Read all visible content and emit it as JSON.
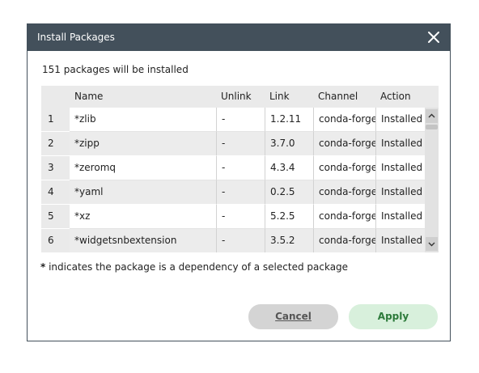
{
  "dialog": {
    "title": "Install Packages",
    "summary": "151 packages will be installed",
    "note_star": "*",
    "note_text": " indicates the package is a dependency of a selected package"
  },
  "table": {
    "columns": [
      "",
      "Name",
      "Unlink",
      "Link",
      "Channel",
      "Action"
    ],
    "rows": [
      {
        "num": "1",
        "name": "*zlib",
        "unlink": "-",
        "link": "1.2.11",
        "channel": "conda-forge",
        "action": "Installed"
      },
      {
        "num": "2",
        "name": "*zipp",
        "unlink": "-",
        "link": "3.7.0",
        "channel": "conda-forge",
        "action": "Installed"
      },
      {
        "num": "3",
        "name": "*zeromq",
        "unlink": "-",
        "link": "4.3.4",
        "channel": "conda-forge",
        "action": "Installed"
      },
      {
        "num": "4",
        "name": "*yaml",
        "unlink": "-",
        "link": "0.2.5",
        "channel": "conda-forge",
        "action": "Installed"
      },
      {
        "num": "5",
        "name": "*xz",
        "unlink": "-",
        "link": "5.2.5",
        "channel": "conda-forge",
        "action": "Installed"
      },
      {
        "num": "6",
        "name": "*widgetsnbextension",
        "unlink": "-",
        "link": "3.5.2",
        "channel": "conda-forge",
        "action": "Installed"
      }
    ]
  },
  "buttons": {
    "cancel": "Cancel",
    "apply": "Apply"
  },
  "icons": {
    "close": "close-icon",
    "scroll_up": "chevron-up-icon",
    "scroll_down": "chevron-down-icon"
  },
  "colors": {
    "titlebar": "#43505b",
    "apply_bg": "#d8f0dc",
    "apply_text": "#2c7a3a",
    "cancel_bg": "#d4d4d4"
  }
}
